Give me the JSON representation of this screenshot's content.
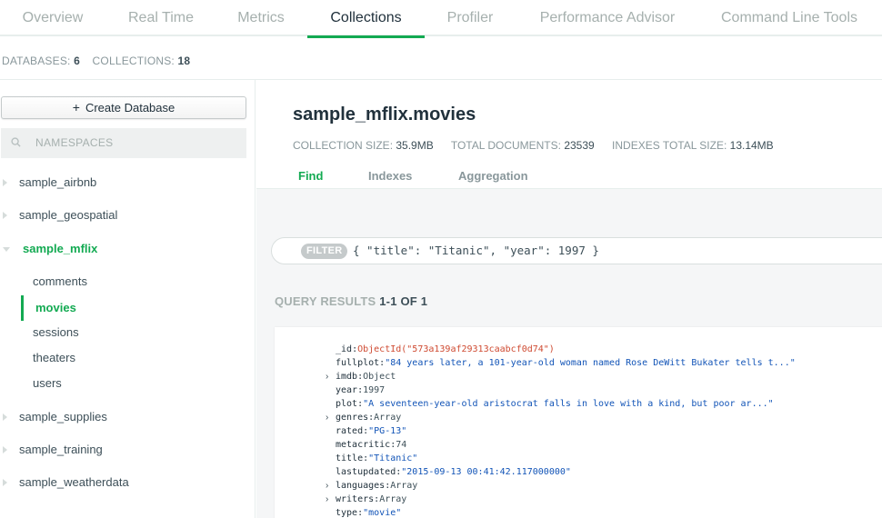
{
  "tabs": [
    "Overview",
    "Real Time",
    "Metrics",
    "Collections",
    "Profiler",
    "Performance Advisor",
    "Command Line Tools"
  ],
  "active_tab": "Collections",
  "summary": {
    "databases_label": "DATABASES:",
    "databases_value": "6",
    "collections_label": "COLLECTIONS:",
    "collections_value": "18"
  },
  "sidebar": {
    "create_label": "Create Database",
    "create_icon": "+",
    "search_placeholder": "NAMESPACES",
    "databases": [
      "sample_airbnb",
      "sample_geospatial",
      "sample_mflix",
      "sample_supplies",
      "sample_training",
      "sample_weatherdata"
    ],
    "active_database": "sample_mflix",
    "collections": [
      "comments",
      "movies",
      "sessions",
      "theaters",
      "users"
    ],
    "active_collection": "movies"
  },
  "main": {
    "title": "sample_mflix.movies",
    "stats": [
      {
        "label": "COLLECTION SIZE:",
        "value": "35.9MB"
      },
      {
        "label": "TOTAL DOCUMENTS:",
        "value": "23539"
      },
      {
        "label": "INDEXES TOTAL SIZE:",
        "value": "13.14MB"
      }
    ],
    "subtabs": [
      "Find",
      "Indexes",
      "Aggregation"
    ],
    "active_subtab": "Find",
    "filter_label": "FILTER",
    "filter_query": "{ \"title\": \"Titanic\", \"year\": 1997 }",
    "results_label": "QUERY RESULTS",
    "results_count": "1-1 OF 1"
  },
  "document": [
    {
      "key": "_id",
      "value": "ObjectId(\"573a139af29313caabcf0d74\")",
      "type": "oid",
      "expandable": false
    },
    {
      "key": "fullplot",
      "value": "\"84 years later, a 101-year-old woman named Rose DeWitt Bukater tells t...\"",
      "type": "str",
      "expandable": false
    },
    {
      "key": "imdb",
      "value": "Object",
      "type": "type",
      "expandable": true
    },
    {
      "key": "year",
      "value": "1997",
      "type": "num",
      "expandable": false
    },
    {
      "key": "plot",
      "value": "\"A seventeen-year-old aristocrat falls in love with a kind, but poor ar...\"",
      "type": "str",
      "expandable": false
    },
    {
      "key": "genres",
      "value": "Array",
      "type": "type",
      "expandable": true
    },
    {
      "key": "rated",
      "value": "\"PG-13\"",
      "type": "str",
      "expandable": false
    },
    {
      "key": "metacritic",
      "value": "74",
      "type": "num",
      "expandable": false
    },
    {
      "key": "title",
      "value": "\"Titanic\"",
      "type": "str",
      "expandable": false
    },
    {
      "key": "lastupdated",
      "value": "\"2015-09-13 00:41:42.117000000\"",
      "type": "str",
      "expandable": false
    },
    {
      "key": "languages",
      "value": "Array",
      "type": "type",
      "expandable": true
    },
    {
      "key": "writers",
      "value": "Array",
      "type": "type",
      "expandable": true
    },
    {
      "key": "type",
      "value": "\"movie\"",
      "type": "str",
      "expandable": false
    }
  ],
  "colors": {
    "accent": "#13aa52",
    "string": "#1254b7",
    "objectid": "#cf4a31"
  }
}
